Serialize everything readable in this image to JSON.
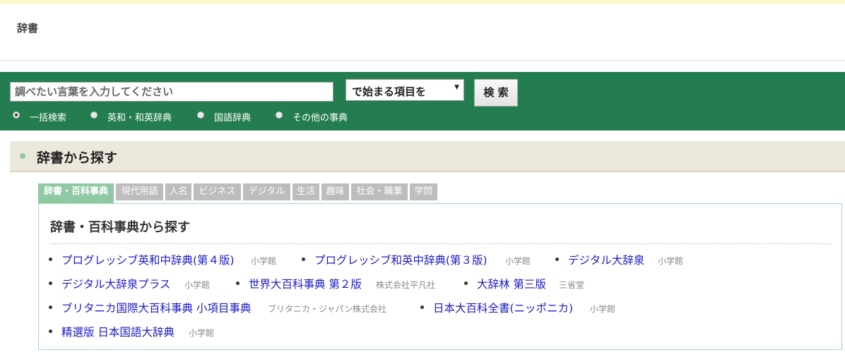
{
  "header": {
    "title": "辞書"
  },
  "search": {
    "placeholder": "調べたい言葉を入力してください",
    "mode": "で始まる項目を",
    "button_label": "検 索",
    "options": [
      {
        "label": "一括検索",
        "checked": true
      },
      {
        "label": "英和・和英辞典",
        "checked": false
      },
      {
        "label": "国語辞典",
        "checked": false
      },
      {
        "label": "その他の事典",
        "checked": false
      }
    ]
  },
  "section": {
    "heading": "辞書から探す"
  },
  "tabs": [
    {
      "label": "辞書・百科事典",
      "active": true
    },
    {
      "label": "現代用語",
      "active": false
    },
    {
      "label": "人名",
      "active": false
    },
    {
      "label": "ビジネス",
      "active": false
    },
    {
      "label": "デジタル",
      "active": false
    },
    {
      "label": "生活",
      "active": false
    },
    {
      "label": "趣味",
      "active": false
    },
    {
      "label": "社会・職業",
      "active": false
    },
    {
      "label": "学問",
      "active": false
    }
  ],
  "panel": {
    "title": "辞書・百科事典から探す",
    "entries": [
      {
        "title": "プログレッシブ英和中辞典(第４版)",
        "publisher": "小学館"
      },
      {
        "title": "プログレッシブ和英中辞典(第３版)",
        "publisher": "小学館"
      },
      {
        "title": "デジタル大辞泉",
        "publisher": "小学館"
      },
      {
        "title": "デジタル大辞泉プラス",
        "publisher": "小学館"
      },
      {
        "title": "世界大百科事典 第２版",
        "publisher": "株式会社平凡社"
      },
      {
        "title": "大辞林 第三版",
        "publisher": "三省堂"
      },
      {
        "title": "ブリタニカ国際大百科事典 小項目事典",
        "publisher": "ブリタニカ・ジャパン株式会社"
      },
      {
        "title": "日本大百科全書(ニッポニカ)",
        "publisher": "小学館"
      },
      {
        "title": "精選版 日本国語大辞典",
        "publisher": "小学館"
      }
    ]
  },
  "colors": {
    "brand_green": "#237d4e",
    "tab_active": "#8fc9a3",
    "tab_inactive": "#bdbdbd",
    "link": "#1a1ac8"
  }
}
